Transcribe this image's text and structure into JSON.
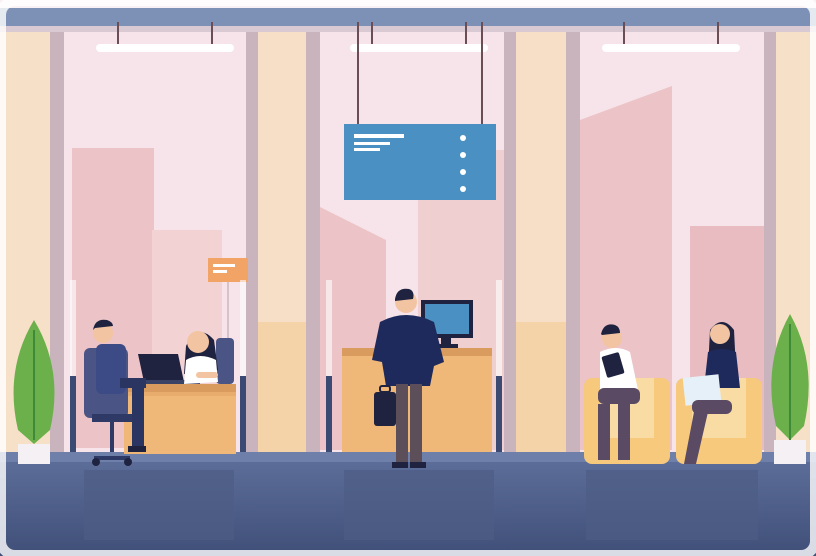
{
  "scene": {
    "description_free": true,
    "palette": {
      "sky_top": "#f7eef3",
      "sky_bottom": "#f1d9dd",
      "building": "#ecc6c8",
      "building_dark": "#dcaab0",
      "wall": "#f7e3cf",
      "column": "#f3dcc2",
      "frame": "#b9a9b3",
      "ceiling": "#7c8fb3",
      "floor": "#5c6e9b",
      "floor_dark": "#46567e",
      "desk": "#f0b878",
      "desk_dark": "#d99c5e",
      "sign": "#4a8fc0",
      "navy": "#2b3561",
      "plant": "#6bb04a",
      "plant_dark": "#3f8a3a",
      "armchair": "#f6c97c",
      "skin": "#f3c4a2",
      "hair_dark": "#1f2340"
    },
    "icons": [
      "ceiling-light-icon",
      "info-sign-icon",
      "monitor-icon",
      "briefcase-icon",
      "plant-icon",
      "armchair-icon"
    ]
  }
}
